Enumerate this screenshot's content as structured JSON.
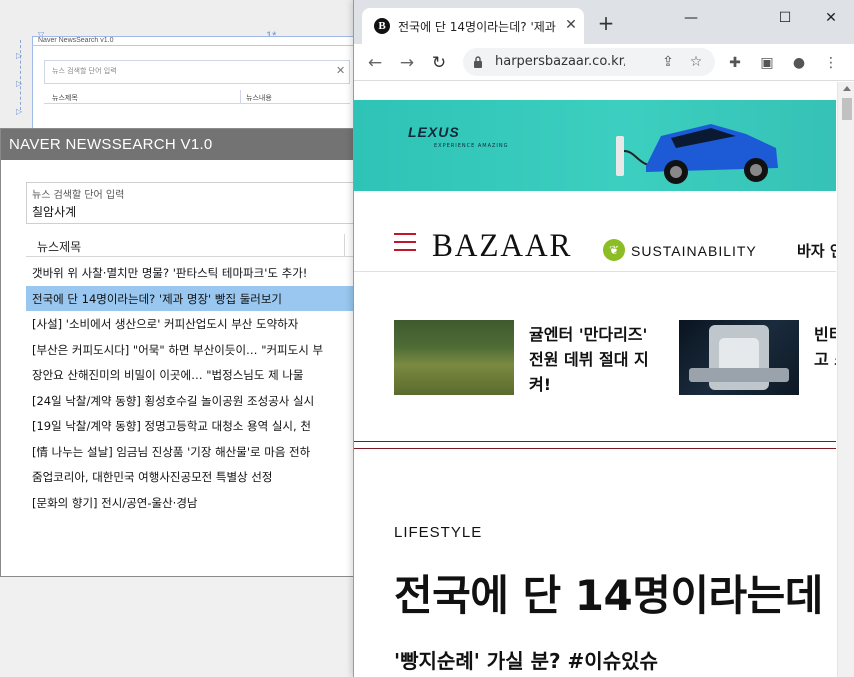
{
  "designer": {
    "frame_title": "Naver NewsSearch v1.0",
    "search_placeholder": "뉴스 검색할 단어 입력",
    "col_title": "뉴스제목",
    "col_content": "뉴스내용",
    "marker": "1*"
  },
  "naver": {
    "title": "NAVER NEWSSEARCH V1.0",
    "search_placeholder": "뉴스 검색할 단어 입력",
    "search_value": "칠암사계",
    "column_header": "뉴스제목",
    "rows": [
      "갯바위 위 사찰·멸치만 명물? '판타스틱 테마파크'도 추가!",
      "전국에 단 14명이라는데? '제과 명장' 빵집 둘러보기",
      "[사설] '소비에서 생산으로' 커피산업도시 부산 도약하자",
      "[부산은 커피도시다] \"어묵\" 하면 부산이듯이… \"커피도시 부",
      "장안요 산해진미의 비밀이 이곳에… \"법정스님도 제 나물",
      "[24일 낙찰/계약 동향] 횡성호수길 놀이공원 조성공사 실시",
      "[19일 낙찰/계약 동향] 정명고등학교 대청소 용역 실시, 천",
      "[情 나누는 설날] 임금님 진상품 '기장 해산물'로 마음 전하",
      "줌업코리아, 대한민국 여행사진공모전 특별상 선정",
      "[문화의 향기] 전시/공연-울산·경남"
    ],
    "selected_index": 1
  },
  "chrome": {
    "tab_title": "전국에 단 14명이라는데? '제과 명장'",
    "favicon_letter": "B",
    "url": "harpersbazaar.co.kr/a...",
    "window_controls": {
      "minimize": "—",
      "maximize": "☐",
      "close": "✕"
    },
    "new_tab": "+"
  },
  "page": {
    "ad_brand": "LEXUS",
    "ad_tagline": "EXPERIENCE AMAZING",
    "logo": "BAZAAR",
    "nav_sustainability": "SUSTAINABILITY",
    "nav_more": "바자 인",
    "card1_text": "귤엔터 '만다리즈' 전원 데뷔 절대 지켜!",
    "card2_text": "빈티지 고 소",
    "category": "LIFESTYLE",
    "headline": "전국에 단 14명이라는데",
    "subhead": "'빵지순례' 가실 분? #이슈있슈"
  },
  "colors": {
    "naver_titlebar": "#737373",
    "selection": "#99c7ef",
    "bazaar_accent": "#c0182a",
    "ad_teal": "#3ccfc0",
    "sustainability_green": "#8cbd24"
  }
}
